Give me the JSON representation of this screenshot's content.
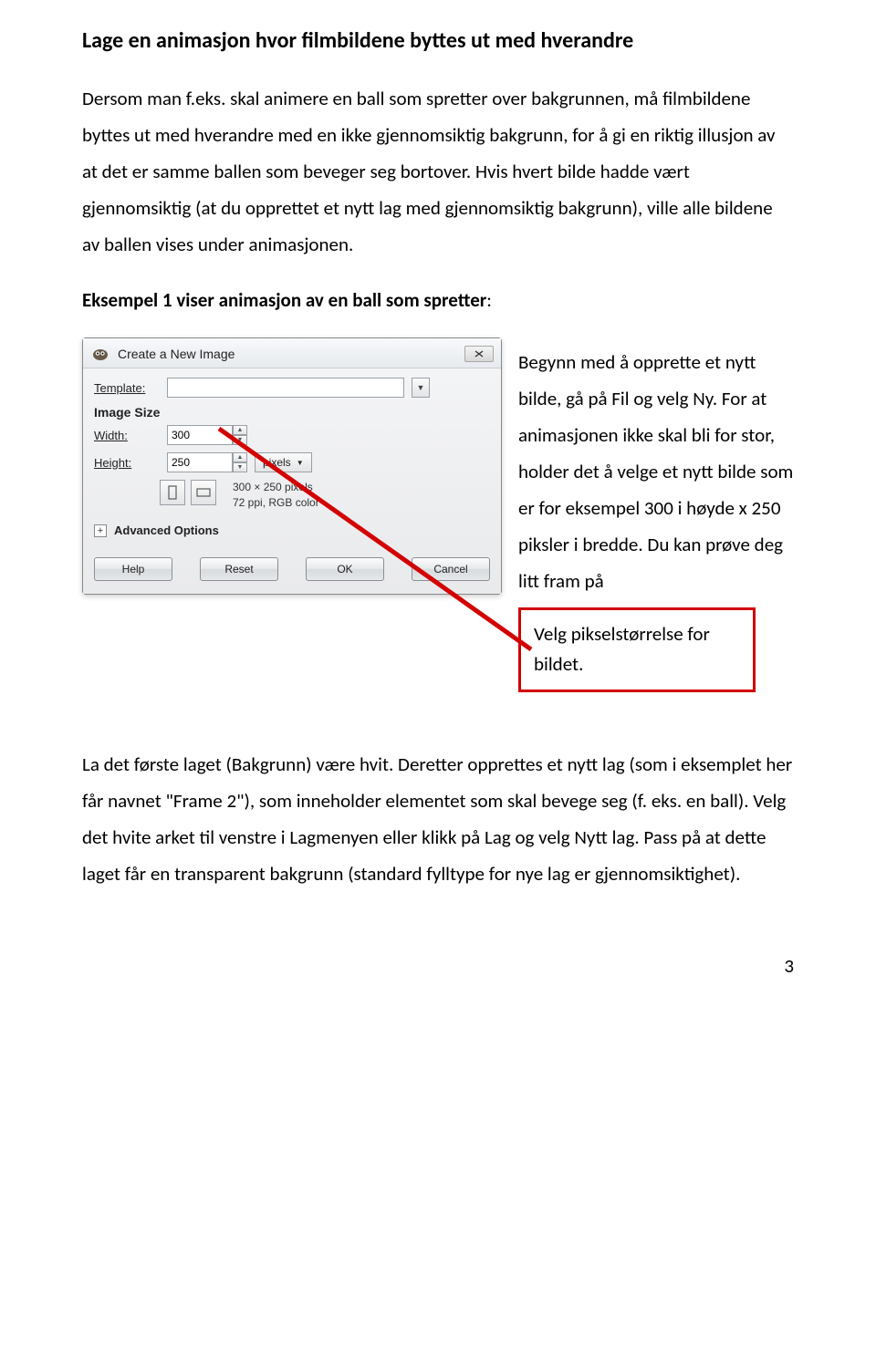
{
  "heading": "Lage en animasjon hvor filmbildene byttes ut med hverandre",
  "para1": "Dersom man f.eks. skal animere en ball som spretter over bakgrunnen, må filmbildene byttes ut med hverandre med en ikke gjennomsiktig bakgrunn, for å gi en riktig illusjon av at det er samme ballen som beveger seg bortover. Hvis hvert bilde hadde vært gjennomsiktig (at du opprettet et nytt lag med gjennomsiktig bakgrunn), ville alle bildene av ballen vises under animasjonen.",
  "subhead_bold": "Eksempel 1 viser animasjon av en ball som spretter",
  "subhead_tail": ":",
  "dialog": {
    "title": "Create a New Image",
    "template_label": "Template:",
    "template_value": "",
    "image_size_label": "Image Size",
    "width_label": "Width:",
    "width_value": "300",
    "height_label": "Height:",
    "height_value": "250",
    "units": "pixels",
    "info_line1": "300 × 250 pixels",
    "info_line2": "72 ppi, RGB color",
    "advanced_label": "Advanced Options",
    "help": "Help",
    "reset": "Reset",
    "ok": "OK",
    "cancel": "Cancel"
  },
  "right_text": "Begynn med å opprette et nytt bilde, gå på Fil og velg Ny. For at animasjonen ikke skal bli for stor, holder det å velge et nytt bilde som er for eksempel 300 i høyde x 250 piksler i bredde. Du kan prøve deg litt fram på",
  "callout_text": "Velg pikselstørrelse for bildet.",
  "para2": "La det første laget (Bakgrunn) være hvit. Deretter opprettes et nytt lag (som i eksemplet her får navnet \"Frame 2\"), som inneholder elementet som skal bevege seg (f. eks. en ball). Velg det hvite arket til venstre i Lagmenyen eller klikk på Lag og velg Nytt lag. Pass på at dette laget får en transparent bakgrunn (standard fylltype for nye lag er gjennomsiktighet).",
  "page_number": "3"
}
